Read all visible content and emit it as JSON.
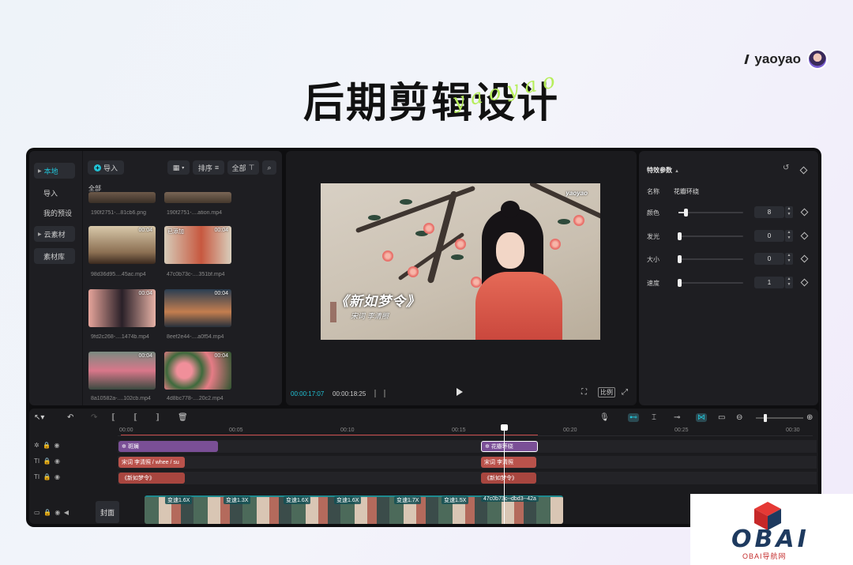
{
  "header": {
    "title": "后期剪辑设计",
    "script": "yaoyao",
    "brand": "yaoyao"
  },
  "library": {
    "nav": [
      "本地",
      "导入",
      "我的预设",
      "云素材",
      "素材库"
    ],
    "toolbar": {
      "import": "导入",
      "sort": "排序",
      "all": "全部"
    },
    "section": "全部",
    "items": [
      {
        "name": "190f2751-...81cb6.png",
        "duration": "",
        "added": ""
      },
      {
        "name": "190f2751-....ation.mp4",
        "duration": "",
        "added": ""
      },
      {
        "name": "98d36d95....45ac.mp4",
        "duration": "00:04",
        "added": ""
      },
      {
        "name": "47c0b73c-....351bf.mp4",
        "duration": "00:04",
        "added": "已添加"
      },
      {
        "name": "9fd2c268-....1474b.mp4",
        "duration": "00:04",
        "added": ""
      },
      {
        "name": "8eef2e44-....a0f54.mp4",
        "duration": "00:04",
        "added": ""
      },
      {
        "name": "8a10582a-....102cb.mp4",
        "duration": "00:04",
        "added": ""
      },
      {
        "name": "4d8bc778-....20c2.mp4",
        "duration": "00:04",
        "added": ""
      }
    ]
  },
  "player": {
    "current_time": "00:00:17:07",
    "total_time": "00:00:18:25",
    "ratio": "比例",
    "poem_title": "《新如梦令》",
    "poem_sub": "宋词 李清照",
    "watermark": "yaoyao"
  },
  "props": {
    "title": "特效参数",
    "name_label": "名称",
    "name_value": "花瓣环绕",
    "params": [
      {
        "label": "颜色",
        "value": "8",
        "level": 0.1
      },
      {
        "label": "发光",
        "value": "0",
        "level": 0
      },
      {
        "label": "大小",
        "value": "0",
        "level": 0
      },
      {
        "label": "速度",
        "value": "1",
        "level": 0
      }
    ]
  },
  "timeline": {
    "ruler": [
      "00:00",
      "00:05",
      "00:10",
      "00:15",
      "00:20",
      "00:25",
      "00:30"
    ],
    "effects_clips": [
      "斑斓",
      "花瓣环绕"
    ],
    "text_clips_1": [
      "宋词 李清照 / whee / su",
      "宋词 李清照"
    ],
    "text_clips_2": [
      "《新如梦令》",
      "《新如梦令》"
    ],
    "speed_labels": [
      "变速1.6X",
      "变速1.3X",
      "变速1.6X",
      "变速1.6X",
      "变速1.7X",
      "变速1.5X"
    ],
    "video_id": "47c0b73c--dbd3--42a",
    "cover": "封面"
  },
  "logo": {
    "text": "OBAI",
    "sub": "OBAI导航网"
  }
}
